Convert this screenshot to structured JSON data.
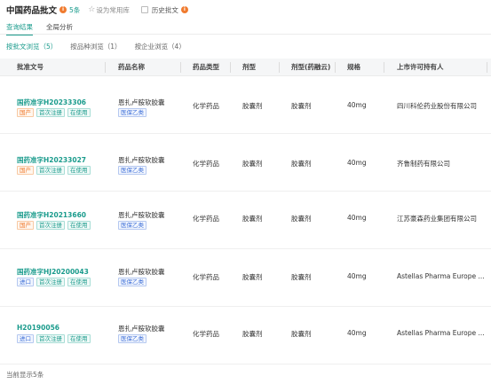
{
  "header": {
    "title": "中国药品批文",
    "count": "5条",
    "favorite_label": "设为常用库",
    "history_label": "历史批文"
  },
  "tabs": [
    {
      "label": "查询结果",
      "active": true
    },
    {
      "label": "全局分析",
      "active": false
    }
  ],
  "subtabs": [
    {
      "label": "按批文浏览（5）",
      "active": true
    },
    {
      "label": "按品种浏览（1）",
      "active": false
    },
    {
      "label": "按企业浏览（4）",
      "active": false
    }
  ],
  "table": {
    "columns": [
      "批准文号",
      "药品名称",
      "药品类型",
      "剂型",
      "剂型(药融云)",
      "规格",
      "上市许可持有人"
    ],
    "rows": [
      {
        "approval": "国药准字H20233306",
        "approval_tags": [
          "国产",
          "首次注册",
          "在使用"
        ],
        "drug_name": "恩扎卢胺软胶囊",
        "drug_tag": "医保乙类",
        "type": "化学药品",
        "form": "胶囊剂",
        "form_yry": "胶囊剂",
        "spec": "40mg",
        "holder": "四川科伦药业股份有限公司"
      },
      {
        "approval": "国药准字H20233027",
        "approval_tags": [
          "国产",
          "首次注册",
          "在使用"
        ],
        "drug_name": "恩扎卢胺软胶囊",
        "drug_tag": "医保乙类",
        "type": "化学药品",
        "form": "胶囊剂",
        "form_yry": "胶囊剂",
        "spec": "40mg",
        "holder": "齐鲁制药有限公司"
      },
      {
        "approval": "国药准字H20213660",
        "approval_tags": [
          "国产",
          "首次注册",
          "在使用"
        ],
        "drug_name": "恩扎卢胺软胶囊",
        "drug_tag": "医保乙类",
        "type": "化学药品",
        "form": "胶囊剂",
        "form_yry": "胶囊剂",
        "spec": "40mg",
        "holder": "江苏豪森药业集团有限公司"
      },
      {
        "approval": "国药准字HJ20200043",
        "approval_tags": [
          "进口",
          "首次注册",
          "在使用"
        ],
        "drug_name": "恩扎卢胺软胶囊",
        "drug_tag": "医保乙类",
        "type": "化学药品",
        "form": "胶囊剂",
        "form_yry": "胶囊剂",
        "spec": "40mg",
        "holder": "Astellas Pharma Europe ..."
      },
      {
        "approval": "H20190056",
        "approval_tags": [
          "进口",
          "首次注册",
          "在使用"
        ],
        "drug_name": "恩扎卢胺软胶囊",
        "drug_tag": "医保乙类",
        "type": "化学药品",
        "form": "胶囊剂",
        "form_yry": "胶囊剂",
        "spec": "40mg",
        "holder": "Astellas Pharma Europe ..."
      }
    ]
  },
  "footer": {
    "text": "当前显示5条"
  },
  "colors": {
    "accent": "#1a9b8c",
    "orange": "#f07b2f",
    "blue": "#3d6fd8"
  }
}
